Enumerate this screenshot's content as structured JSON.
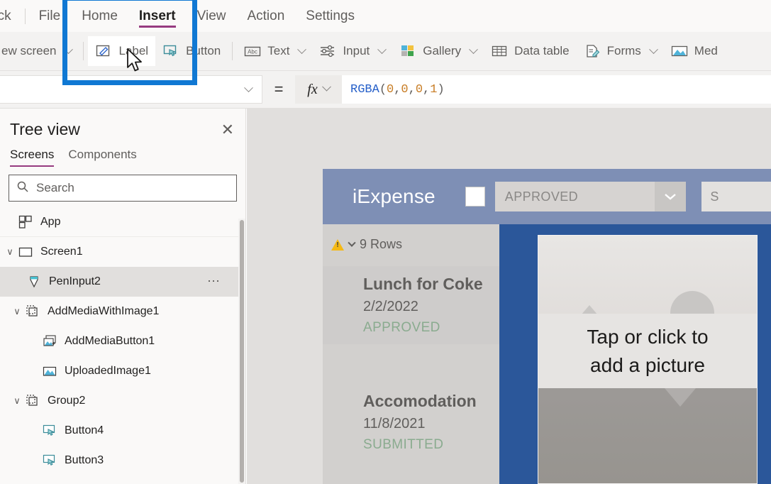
{
  "menubar": {
    "items": [
      {
        "label": "ack",
        "active": false
      },
      {
        "label": "File",
        "active": false
      },
      {
        "label": "Home",
        "active": false
      },
      {
        "label": "Insert",
        "active": true
      },
      {
        "label": "View",
        "active": false
      },
      {
        "label": "Action",
        "active": false
      },
      {
        "label": "Settings",
        "active": false
      }
    ],
    "active_tab_accent": "#963B80"
  },
  "ribbon": {
    "items": [
      {
        "label": "ew screen",
        "icon": "new-screen-icon",
        "caret": true,
        "highlighted": false
      },
      {
        "label": "Label",
        "icon": "label-icon",
        "caret": false,
        "highlighted": true
      },
      {
        "label": "Button",
        "icon": "button-icon",
        "caret": false,
        "highlighted": false
      },
      {
        "label": "Text",
        "icon": "text-icon",
        "caret": true,
        "highlighted": false
      },
      {
        "label": "Input",
        "icon": "input-icon",
        "caret": true,
        "highlighted": false
      },
      {
        "label": "Gallery",
        "icon": "gallery-icon",
        "caret": true,
        "highlighted": false
      },
      {
        "label": "Data table",
        "icon": "data-table-icon",
        "caret": false,
        "highlighted": false
      },
      {
        "label": "Forms",
        "icon": "forms-icon",
        "caret": true,
        "highlighted": false
      },
      {
        "label": "Med",
        "icon": "media-icon",
        "caret": false,
        "highlighted": false
      }
    ]
  },
  "formula_bar": {
    "property_value": "",
    "equals": "=",
    "fx_label": "fx",
    "formula": "RGBA(0, 0, 0, 1)",
    "formula_tokens": {
      "fn": "RGBA",
      "open": "(",
      "a": "0",
      "c1": ", ",
      "b": "0",
      "c2": ", ",
      "c": "0",
      "c3": ", ",
      "d": "1",
      "close": ")"
    }
  },
  "treeview": {
    "title": "Tree view",
    "close_label": "✕",
    "tabs": [
      {
        "label": "Screens",
        "active": true
      },
      {
        "label": "Components",
        "active": false
      }
    ],
    "search_placeholder": "Search",
    "items": [
      {
        "label": "App",
        "icon": "app-icon",
        "indent": 0,
        "chevron": "",
        "selected": false,
        "ellipsis": false,
        "divider": true
      },
      {
        "label": "Screen1",
        "icon": "screen-icon",
        "indent": 0,
        "chevron": "∨",
        "selected": false,
        "ellipsis": false,
        "divider": false
      },
      {
        "label": "PenInput2",
        "icon": "pen-input-icon",
        "indent": 1,
        "chevron": "",
        "selected": true,
        "ellipsis": true,
        "divider": false
      },
      {
        "label": "AddMediaWithImage1",
        "icon": "group-icon",
        "indent": 1,
        "chevron": "∨",
        "selected": false,
        "ellipsis": false,
        "divider": false
      },
      {
        "label": "AddMediaButton1",
        "icon": "add-media-icon",
        "indent": 2,
        "chevron": "",
        "selected": false,
        "ellipsis": false,
        "divider": false
      },
      {
        "label": "UploadedImage1",
        "icon": "image-icon",
        "indent": 2,
        "chevron": "",
        "selected": false,
        "ellipsis": false,
        "divider": false
      },
      {
        "label": "Group2",
        "icon": "group-icon",
        "indent": 1,
        "chevron": "∨",
        "selected": false,
        "ellipsis": false,
        "divider": false
      },
      {
        "label": "Button4",
        "icon": "button-icon",
        "indent": 2,
        "chevron": "",
        "selected": false,
        "ellipsis": false,
        "divider": false
      },
      {
        "label": "Button3",
        "icon": "button-icon",
        "indent": 2,
        "chevron": "",
        "selected": false,
        "ellipsis": false,
        "divider": false
      }
    ]
  },
  "app_preview": {
    "header": {
      "title": "iExpense",
      "checkbox_checked": false,
      "dropdown_value": "APPROVED",
      "search_text": "S"
    },
    "list": {
      "rows_label": "9 Rows",
      "cards": [
        {
          "title": "Lunch for Coke",
          "date": "2/2/2022",
          "status": "APPROVED"
        },
        {
          "title": "Accomodation",
          "date": "11/8/2021",
          "status": "SUBMITTED"
        }
      ]
    },
    "picture_placeholder": {
      "line1": "Tap or click to",
      "line2": "add a picture"
    },
    "colors": {
      "header_bg": "#7e8fb5",
      "detail_bg": "#2b579a",
      "list_bg": "#d2d0ce",
      "status_green": "#8aab8f"
    }
  },
  "annotation": {
    "highlight_color": "#1078d3",
    "cursor": "mouse-pointer"
  }
}
